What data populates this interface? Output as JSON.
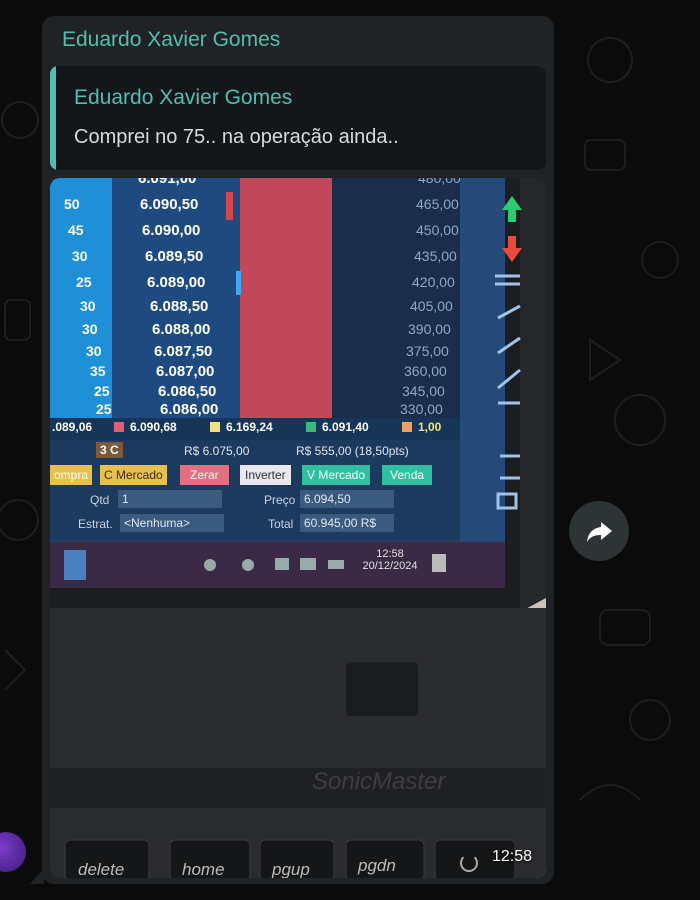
{
  "message": {
    "sender": "Eduardo Xavier Gomes",
    "quoted": {
      "sender": "Eduardo Xavier Gomes",
      "text": "Comprei no 75.. na operação ainda.."
    },
    "time": "12:58"
  },
  "photo": {
    "book": {
      "rows": [
        {
          "qty": "",
          "price": "6.091,00",
          "right": "480,00"
        },
        {
          "qty": "50",
          "price": "6.090,50",
          "right": "465,00"
        },
        {
          "qty": "45",
          "price": "6.090,00",
          "right": "450,00"
        },
        {
          "qty": "30",
          "price": "6.089,50",
          "right": "435,00"
        },
        {
          "qty": "25",
          "price": "6.089,00",
          "right": "420,00"
        },
        {
          "qty": "30",
          "price": "6.088,50",
          "right": "405,00"
        },
        {
          "qty": "30",
          "price": "6.088,00",
          "right": "390,00"
        },
        {
          "qty": "30",
          "price": "6.087,50",
          "right": "375,00"
        },
        {
          "qty": "35",
          "price": "6.087,00",
          "right": "360,00"
        },
        {
          "qty": "25",
          "price": "6.086,50",
          "right": "345,00"
        },
        {
          "qty": "25",
          "price": "6.086,00",
          "right": "330,00"
        }
      ]
    },
    "stats": [
      {
        "value": ".089,06",
        "color": ""
      },
      {
        "value": "6.090,68",
        "color": "#e06070"
      },
      {
        "value": "6.169,24",
        "color": "#f0e080"
      },
      {
        "value": "6.091,40",
        "color": "#3cb878"
      },
      {
        "value": "1,00",
        "color": "#f0a060"
      }
    ],
    "summary": {
      "lots": "3 C",
      "avg": "R$ 6.075,00",
      "pnl": "R$ 555,00 (18,50pts)"
    },
    "buttons": [
      "ompra",
      "C Mercado",
      "Zerar",
      "Inverter",
      "V Mercado",
      "Venda"
    ],
    "form": {
      "qty_label": "Qtd",
      "qty_value": "1",
      "price_label": "Preço",
      "price_value": "6.094,50",
      "strategy_label": "Estrat.",
      "strategy_value": "<Nenhuma>",
      "total_label": "Total",
      "total_value": "60.945,00 R$"
    },
    "taskbar": {
      "time": "12:58",
      "date": "20/12/2024"
    },
    "laptop_brand": "SonicMaster",
    "keys": [
      "delete",
      "home",
      "pgup",
      "pgdn"
    ]
  },
  "colors": {
    "accent": "#53bdb0",
    "bubble": "#1f2326"
  }
}
